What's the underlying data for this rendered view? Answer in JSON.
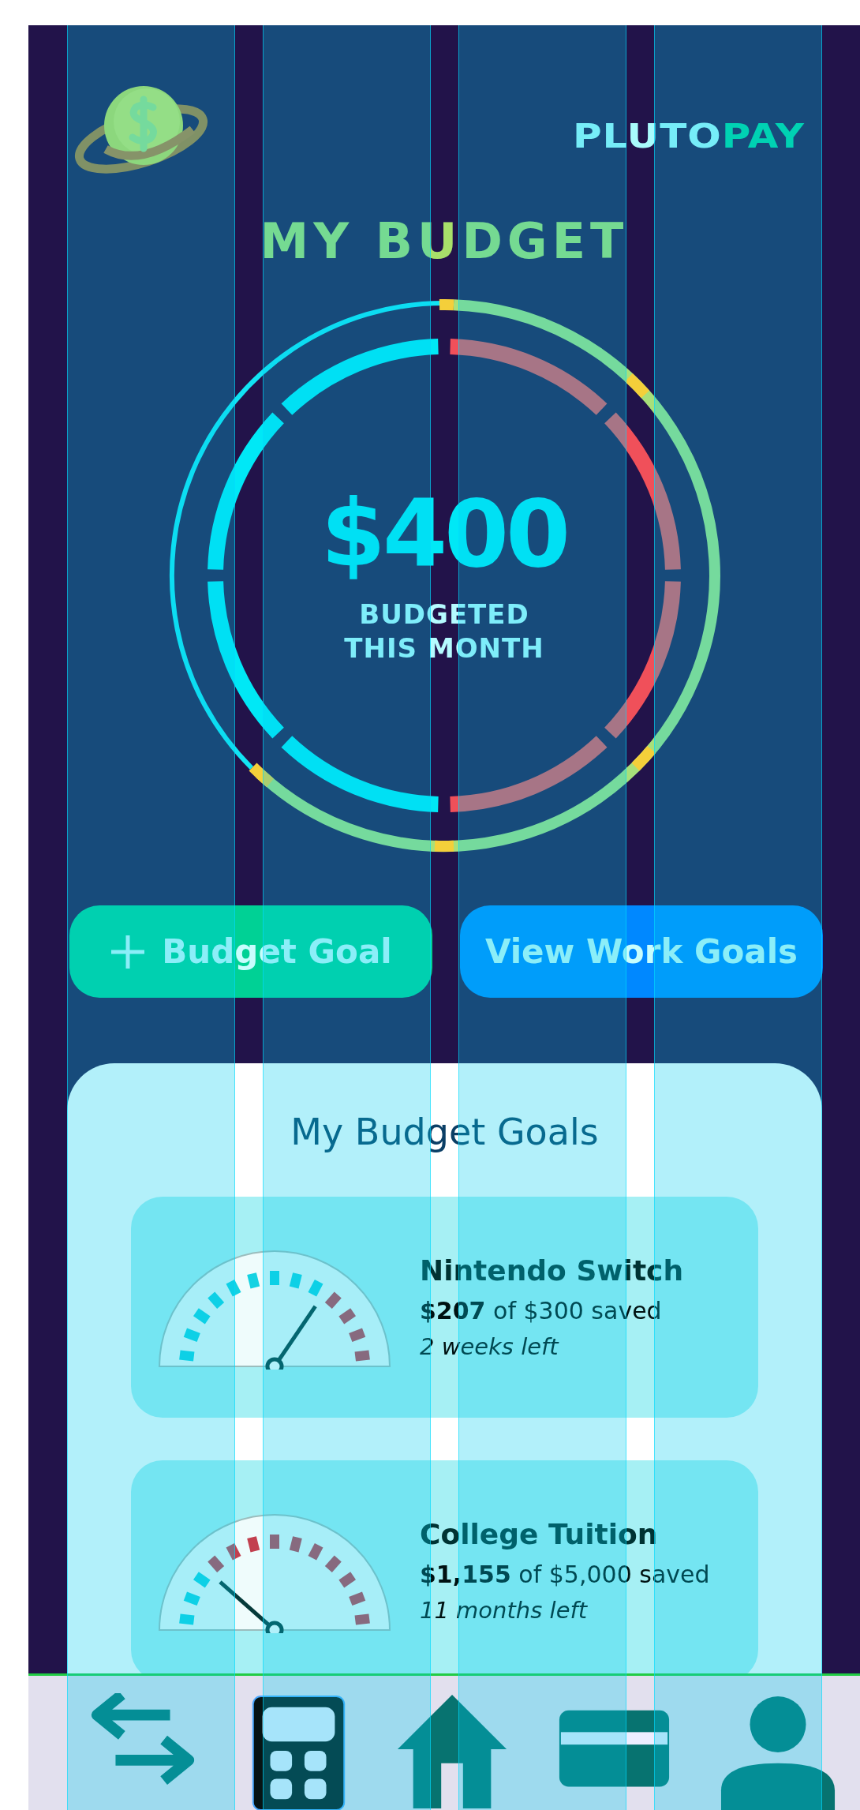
{
  "header": {
    "brand_first": "PLUTO",
    "brand_second": "PAY"
  },
  "title": "MY BUDGET",
  "summary": {
    "amount": "$400",
    "caption": "BUDGETED THIS MONTH"
  },
  "buttons": [
    {
      "label": "Budget Goal",
      "kind": "add"
    },
    {
      "label": "View Work Goals",
      "kind": "view"
    }
  ],
  "goals": {
    "title": "My Budget Goals",
    "items": [
      {
        "name": "Nintendo Switch",
        "progress": "**$207** of $300 saved",
        "time_left": "2 weeks left"
      },
      {
        "name": "College Tuition",
        "progress": "**$1,155** of $5,000 saved",
        "time_left": "11 months left"
      }
    ]
  },
  "nav": [
    {
      "kind": "transfer",
      "selected": false
    },
    {
      "kind": "calculator",
      "selected": true
    },
    {
      "kind": "home",
      "selected": false
    },
    {
      "kind": "card",
      "selected": false
    },
    {
      "kind": "profile",
      "selected": false
    }
  ]
}
